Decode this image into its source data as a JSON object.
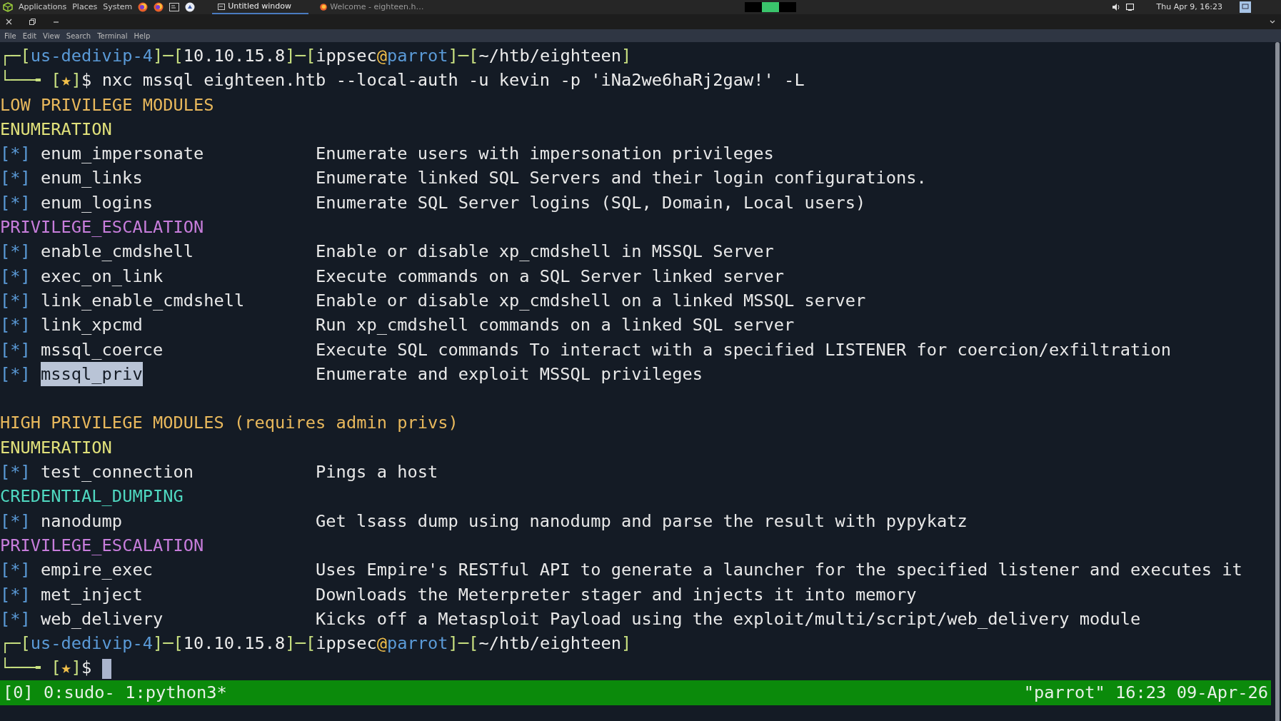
{
  "top_panel": {
    "menus": [
      "Applications",
      "Places",
      "System"
    ],
    "tasks": [
      {
        "title": "Untitled window",
        "selected": true
      },
      {
        "title": "Welcome - eighteen.h…",
        "selected": false
      }
    ],
    "clock": "Thu Apr  9, 16:23"
  },
  "menu_bar": [
    "File",
    "Edit",
    "View",
    "Search",
    "Terminal",
    "Help"
  ],
  "terminal": {
    "lines": [
      {
        "kind": "prompt_top",
        "segments": [
          {
            "kind": "frame",
            "text": "┌─["
          },
          {
            "kind": "vpn",
            "text": "us-dedivip-4"
          },
          {
            "kind": "frame",
            "text": "]─["
          },
          {
            "kind": "plain",
            "text": "10.10.15.8"
          },
          {
            "kind": "frame",
            "text": "]─["
          },
          {
            "kind": "plain",
            "text": "ippsec"
          },
          {
            "kind": "at",
            "text": "@"
          },
          {
            "kind": "vpn",
            "text": "parrot"
          },
          {
            "kind": "frame",
            "text": "]─["
          },
          {
            "kind": "plain",
            "text": "~/htb/eighteen"
          },
          {
            "kind": "frame",
            "text": "]"
          }
        ]
      },
      {
        "kind": "prompt_bottom",
        "segments": [
          {
            "kind": "frame",
            "text": "└──╼ ["
          },
          {
            "kind": "at",
            "text": "★"
          },
          {
            "kind": "frame",
            "text": "]"
          },
          {
            "kind": "plain",
            "text": "$ nxc mssql eighteen.htb --local-auth -u kevin -p 'iNa2we6haRj2gaw!' -L"
          }
        ],
        "cursor": false
      },
      {
        "kind": "heading",
        "text": "LOW PRIVILEGE MODULES",
        "color": "#e8b85c"
      },
      {
        "kind": "heading",
        "text": "ENUMERATION",
        "color": "#e0e07a"
      },
      {
        "kind": "module",
        "marker": "[*]",
        "name": "enum_impersonate",
        "description": "Enumerate users with impersonation privileges",
        "selected": false
      },
      {
        "kind": "module",
        "marker": "[*]",
        "name": "enum_links",
        "description": "Enumerate linked SQL Servers and their login configurations.",
        "selected": false
      },
      {
        "kind": "module",
        "marker": "[*]",
        "name": "enum_logins",
        "description": "Enumerate SQL Server logins (SQL, Domain, Local users)",
        "selected": false
      },
      {
        "kind": "heading",
        "text": "PRIVILEGE_ESCALATION",
        "color": "#c77ddb"
      },
      {
        "kind": "module",
        "marker": "[*]",
        "name": "enable_cmdshell",
        "description": "Enable or disable xp_cmdshell in MSSQL Server",
        "selected": false
      },
      {
        "kind": "module",
        "marker": "[*]",
        "name": "exec_on_link",
        "description": "Execute commands on a SQL Server linked server",
        "selected": false
      },
      {
        "kind": "module",
        "marker": "[*]",
        "name": "link_enable_cmdshell",
        "description": "Enable or disable xp_cmdshell on a linked MSSQL server",
        "selected": false
      },
      {
        "kind": "module",
        "marker": "[*]",
        "name": "link_xpcmd",
        "description": "Run xp_cmdshell commands on a linked SQL server",
        "selected": false
      },
      {
        "kind": "module",
        "marker": "[*]",
        "name": "mssql_coerce",
        "description": "Execute SQL commands To interact with a specified LISTENER for coercion/exfiltration",
        "selected": false
      },
      {
        "kind": "module",
        "marker": "[*]",
        "name": "mssql_priv",
        "description": "Enumerate and exploit MSSQL privileges",
        "selected": true
      },
      {
        "kind": "blank"
      },
      {
        "kind": "heading",
        "text": "HIGH PRIVILEGE MODULES (requires admin privs)",
        "color": "#e8b85c"
      },
      {
        "kind": "heading",
        "text": "ENUMERATION",
        "color": "#e0e07a"
      },
      {
        "kind": "module",
        "marker": "[*]",
        "name": "test_connection",
        "description": "Pings a host",
        "selected": false
      },
      {
        "kind": "heading",
        "text": "CREDENTIAL_DUMPING",
        "color": "#4fd8c0"
      },
      {
        "kind": "module",
        "marker": "[*]",
        "name": "nanodump",
        "description": "Get lsass dump using nanodump and parse the result with pypykatz",
        "selected": false
      },
      {
        "kind": "heading",
        "text": "PRIVILEGE_ESCALATION",
        "color": "#c77ddb"
      },
      {
        "kind": "module",
        "marker": "[*]",
        "name": "empire_exec",
        "description": "Uses Empire's RESTful API to generate a launcher for the specified listener and executes it",
        "selected": false
      },
      {
        "kind": "module",
        "marker": "[*]",
        "name": "met_inject",
        "description": "Downloads the Meterpreter stager and injects it into memory",
        "selected": false
      },
      {
        "kind": "module",
        "marker": "[*]",
        "name": "web_delivery",
        "description": "Kicks off a Metasploit Payload using the exploit/multi/script/web_delivery module",
        "selected": false
      },
      {
        "kind": "prompt_top",
        "segments": [
          {
            "kind": "frame",
            "text": "┌─["
          },
          {
            "kind": "vpn",
            "text": "us-dedivip-4"
          },
          {
            "kind": "frame",
            "text": "]─["
          },
          {
            "kind": "plain",
            "text": "10.10.15.8"
          },
          {
            "kind": "frame",
            "text": "]─["
          },
          {
            "kind": "plain",
            "text": "ippsec"
          },
          {
            "kind": "at",
            "text": "@"
          },
          {
            "kind": "vpn",
            "text": "parrot"
          },
          {
            "kind": "frame",
            "text": "]─["
          },
          {
            "kind": "plain",
            "text": "~/htb/eighteen"
          },
          {
            "kind": "frame",
            "text": "]"
          }
        ]
      },
      {
        "kind": "prompt_bottom",
        "segments": [
          {
            "kind": "frame",
            "text": "└──╼ ["
          },
          {
            "kind": "at",
            "text": "★"
          },
          {
            "kind": "frame",
            "text": "]"
          },
          {
            "kind": "plain",
            "text": "$"
          }
        ],
        "cursor": true
      }
    ]
  },
  "status_bar": {
    "left": "[0] 0:sudo- 1:python3*",
    "right": "\"parrot\" 16:23 09-Apr-26"
  }
}
